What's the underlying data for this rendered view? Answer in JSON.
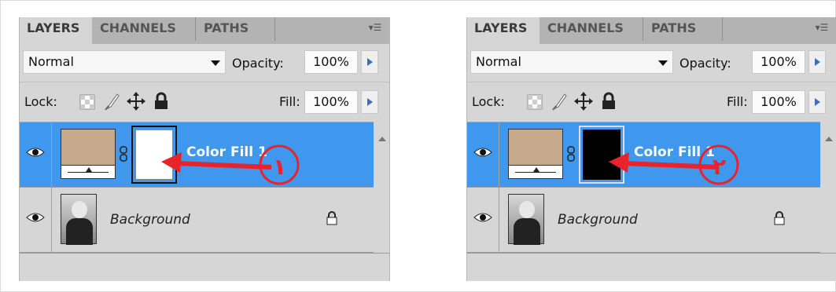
{
  "tabs": [
    "LAYERS",
    "CHANNELS",
    "PATHS"
  ],
  "blend_mode": "Normal",
  "opacity_label": "Opacity:",
  "opacity_value": "100%",
  "lock_label": "Lock:",
  "fill_label": "Fill:",
  "fill_value": "100%",
  "icons": [
    "eye-icon",
    "chain-link-icon",
    "lock-icon",
    "brush-icon",
    "move-icon",
    "panel-menu-icon"
  ],
  "colors": {
    "selection": "#3f97ee",
    "fill_swatch": "#c5a98a",
    "annotation": "#e8232a"
  },
  "panels": [
    {
      "layers": [
        {
          "name": "Color Fill 1",
          "selected": true,
          "mask_color": "#ffffff"
        },
        {
          "name": "Background",
          "selected": false,
          "locked": true
        }
      ],
      "annotation_number": "١"
    },
    {
      "layers": [
        {
          "name": "Color Fill 1",
          "selected": true,
          "mask_color": "#000000"
        },
        {
          "name": "Background",
          "selected": false,
          "locked": true
        }
      ],
      "annotation_number": "٢"
    }
  ]
}
